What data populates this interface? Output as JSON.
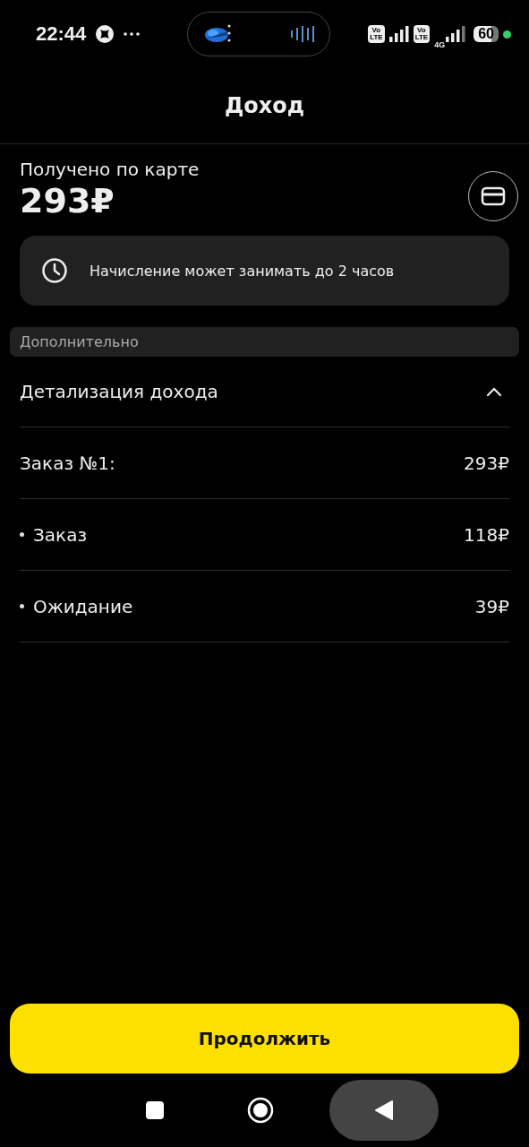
{
  "status_bar": {
    "time": "22:44",
    "badges": [
      {
        "top": "Vo",
        "bottom": "LTE"
      },
      {
        "top": "Vo",
        "bottom": "LTE"
      }
    ],
    "network": "4G",
    "battery": "60"
  },
  "header": {
    "title": "Доход"
  },
  "received": {
    "label": "Получено по карте",
    "amount": "293₽"
  },
  "notice": {
    "text": "Начисление может занимать до 2 часов"
  },
  "section": {
    "label": "Дополнительно"
  },
  "details": {
    "title": "Детализация дохода",
    "expanded": true,
    "rows": [
      {
        "kind": "total",
        "label": "Заказ №1:",
        "amount": "293₽"
      },
      {
        "kind": "item",
        "label": "Заказ",
        "amount": "118₽"
      },
      {
        "kind": "item",
        "label": "Ожидание",
        "amount": "39₽"
      }
    ]
  },
  "continue_button": {
    "label": "Продолжить"
  }
}
